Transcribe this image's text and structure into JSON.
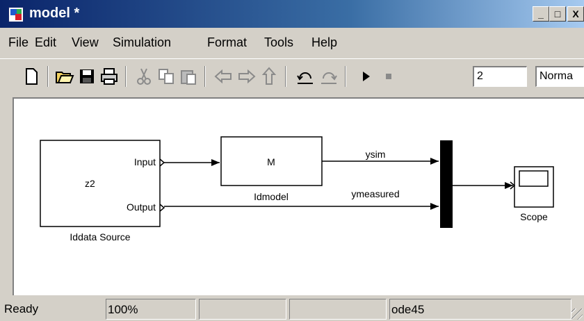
{
  "window": {
    "title": "model *",
    "controls": {
      "minimize": "_",
      "maximize": "□",
      "close": "X"
    }
  },
  "menu": [
    "File",
    "Edit",
    "View",
    "Simulation",
    "Format",
    "Tools",
    "Help"
  ],
  "toolbar": {
    "icons": [
      "new-file-icon",
      "open-folder-icon",
      "save-icon",
      "print-icon",
      "cut-icon",
      "copy-icon",
      "paste-icon",
      "back-arrow-icon",
      "forward-arrow-icon",
      "up-arrow-icon",
      "undo-icon",
      "redo-icon",
      "play-icon",
      "stop-icon"
    ],
    "stop_time": "2",
    "sim_mode": "Norma"
  },
  "diagram": {
    "blocks": {
      "source": {
        "content": "z2",
        "port_in": "Input",
        "port_out": "Output",
        "caption": "Iddata Source"
      },
      "model": {
        "content": "M",
        "caption": "Idmodel"
      },
      "scope": {
        "caption": "Scope"
      }
    },
    "signals": {
      "ysim": "ysim",
      "ymeasured": "ymeasured"
    }
  },
  "status": {
    "state": "Ready",
    "zoom": "100%",
    "field3": "",
    "field4": "",
    "solver": "ode45"
  }
}
